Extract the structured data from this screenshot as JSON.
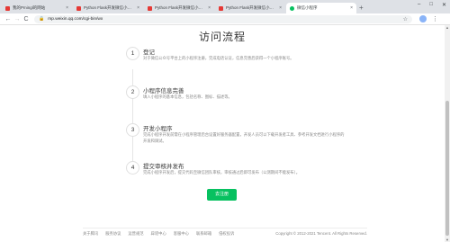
{
  "browser": {
    "tabs": [
      {
        "label": "我的Pmingl的网站",
        "favicon_color": "#e53935",
        "active": false
      },
      {
        "label": "Python Flask开发微信小程序(…",
        "favicon_color": "#e53935",
        "active": false
      },
      {
        "label": "Python Flask开发微信小程序(…",
        "favicon_color": "#e53935",
        "active": false
      },
      {
        "label": "Python Flask开发微信小程序(…",
        "favicon_color": "#e53935",
        "active": false
      },
      {
        "label": "微信小程序",
        "favicon_color": "#07c160",
        "active": true
      }
    ],
    "new_tab": "+",
    "window_controls": {
      "minimize": "–",
      "maximize": "□",
      "close": "✕"
    },
    "url": "mp.weixin.qq.com/cgi-bin/wx",
    "back": "←",
    "forward": "→",
    "reload": "C",
    "star": "☆",
    "menu": "⋮"
  },
  "page": {
    "title": "访问流程",
    "steps": [
      {
        "number": "1",
        "title": "登记",
        "desc": "对于微信公众号平台上的小程序注册，完成电话认证，信息完善后获得一个小程序账号。"
      },
      {
        "number": "2",
        "title": "小程序信息完善",
        "desc": "填入小程序的基本信息，包括名称、图标、描述等。"
      },
      {
        "number": "3",
        "title": "开发小程序",
        "desc": "完成小程序开发前需在小程序管理后台设置好服务器配置，开发人员可以下载开发者工具、参考开发文档进行小程序的开发和调试。"
      },
      {
        "number": "4",
        "title": "提交审核并发布",
        "desc": "完成小程序开发后，提交代码至微信团队审核，审核通过后即可发布（公测期间不能发布）。"
      }
    ],
    "cta_label": "去注册"
  },
  "footer": {
    "links": [
      "关于腾讯",
      "服务协议",
      "运营规范",
      "辟谣中心",
      "客服中心",
      "联系邮箱",
      "侵权投诉"
    ],
    "copyright": "Copyright © 2012-2021 Tencent. All Rights Reserved."
  }
}
